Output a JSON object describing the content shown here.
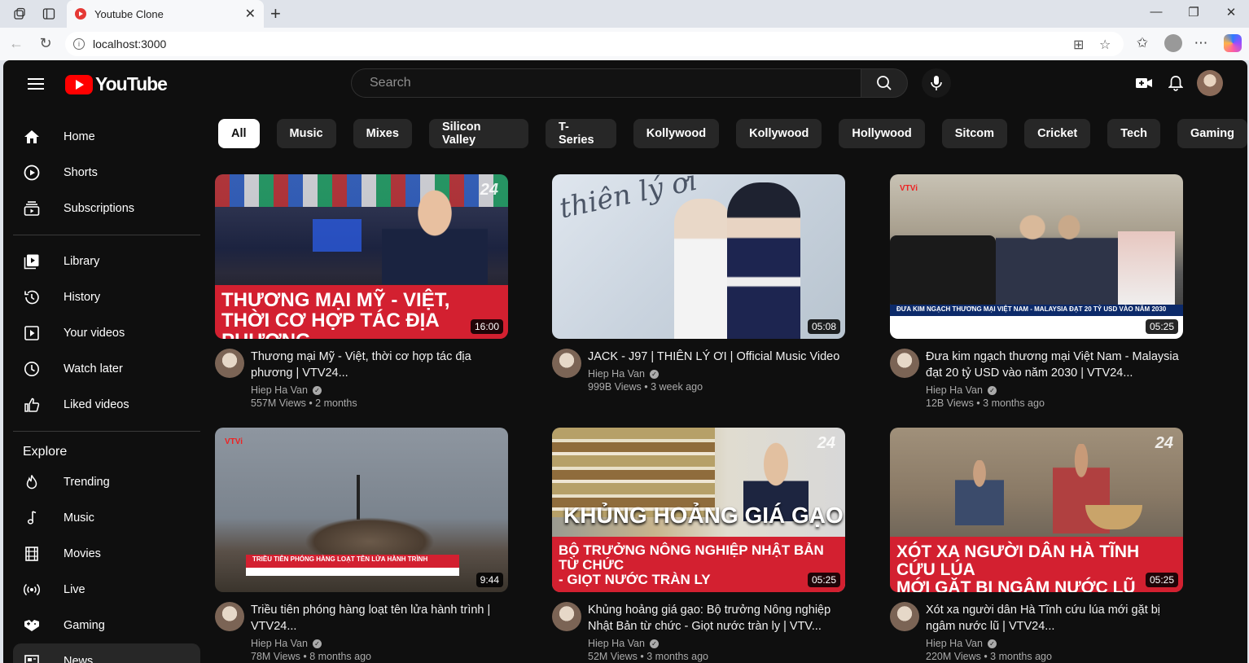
{
  "browser": {
    "tab_title": "Youtube Clone",
    "url": "localhost:3000"
  },
  "header": {
    "logo_text": "YouTube",
    "search_placeholder": "Search"
  },
  "sidebar": {
    "main": [
      {
        "label": "Home",
        "icon": "home-icon"
      },
      {
        "label": "Shorts",
        "icon": "shorts-icon"
      },
      {
        "label": "Subscriptions",
        "icon": "subscriptions-icon"
      }
    ],
    "library": [
      {
        "label": "Library",
        "icon": "library-icon"
      },
      {
        "label": "History",
        "icon": "history-icon"
      },
      {
        "label": "Your videos",
        "icon": "your-videos-icon"
      },
      {
        "label": "Watch later",
        "icon": "watch-later-icon"
      },
      {
        "label": "Liked videos",
        "icon": "liked-videos-icon"
      }
    ],
    "explore_heading": "Explore",
    "explore": [
      {
        "label": "Trending",
        "icon": "trending-icon"
      },
      {
        "label": "Music",
        "icon": "music-icon"
      },
      {
        "label": "Movies",
        "icon": "movies-icon"
      },
      {
        "label": "Live",
        "icon": "live-icon"
      },
      {
        "label": "Gaming",
        "icon": "gaming-icon"
      },
      {
        "label": "News",
        "icon": "news-icon"
      }
    ]
  },
  "chips": [
    "All",
    "Music",
    "Mixes",
    "Silicon Valley",
    "T-Series",
    "Kollywood",
    "Kollywood",
    "Hollywood",
    "Sitcom",
    "Cricket",
    "Tech",
    "Gaming"
  ],
  "videos": [
    {
      "title": "Thương mại Mỹ - Việt, thời cơ hợp tác địa phương | VTV24...",
      "channel": "Hiep Ha Van",
      "stats": "557M Views • 2 months",
      "duration": "16:00",
      "thumb_caption": "THƯƠNG MẠI MỸ - VIỆT,\nTHỜI CƠ HỢP TÁC ĐỊA PHƯƠNG"
    },
    {
      "title": "JACK - J97 | THIÊN LÝ ƠI | Official Music Video",
      "channel": "Hiep Ha Van",
      "stats": "999B Views • 3 week ago",
      "duration": "05:08",
      "thumb_caption": "thiên lý ơi"
    },
    {
      "title": "Đưa kim ngạch thương mại Việt Nam - Malaysia đạt 20 tỷ USD vào năm 2030 | VTV24...",
      "channel": "Hiep Ha Van",
      "stats": "12B Views • 3 months ago",
      "duration": "05:25",
      "thumb_caption": "ĐƯA KIM NGẠCH THƯƠNG MẠI VIỆT NAM - MALAYSIA ĐẠT 20 TỶ USD VÀO NĂM 2030"
    },
    {
      "title": "Triều tiên phóng hàng loạt tên lửa hành trình | VTV24...",
      "channel": "Hiep Ha Van",
      "stats": "78M Views • 8 months ago",
      "duration": "9:44",
      "thumb_caption": "TRIỀU TIÊN PHÓNG HÀNG LOẠT TÊN LỬA HÀNH TRÌNH"
    },
    {
      "title": "Khủng hoảng giá gạo: Bộ trưởng Nông nghiệp Nhật Bản từ chức - Giọt nước tràn ly | VTV...",
      "channel": "Hiep Ha Van",
      "stats": "52M Views • 3 months ago",
      "duration": "05:25",
      "thumb_caption": "KHỦNG HOẢNG GIÁ GẠO"
    },
    {
      "title": "Xót xa người dân Hà Tĩnh cứu lúa mới gặt bị ngâm nước lũ | VTV24...",
      "channel": "Hiep Ha Van",
      "stats": "220M Views • 3 months ago",
      "duration": "05:25",
      "thumb_caption": "XÓT XA NGƯỜI DÂN HÀ TĨNH CỨU LÚA\nMỚI GẶT BỊ NGÂM NƯỚC LŨ"
    }
  ],
  "thumb_extra": {
    "v5_sub": "BỘ TRƯỞNG NÔNG NGHIỆP NHẬT BẢN TỪ CHỨC\n- GIỌT NƯỚC TRÀN LY",
    "badge": "24",
    "vtv": "VTVi"
  }
}
